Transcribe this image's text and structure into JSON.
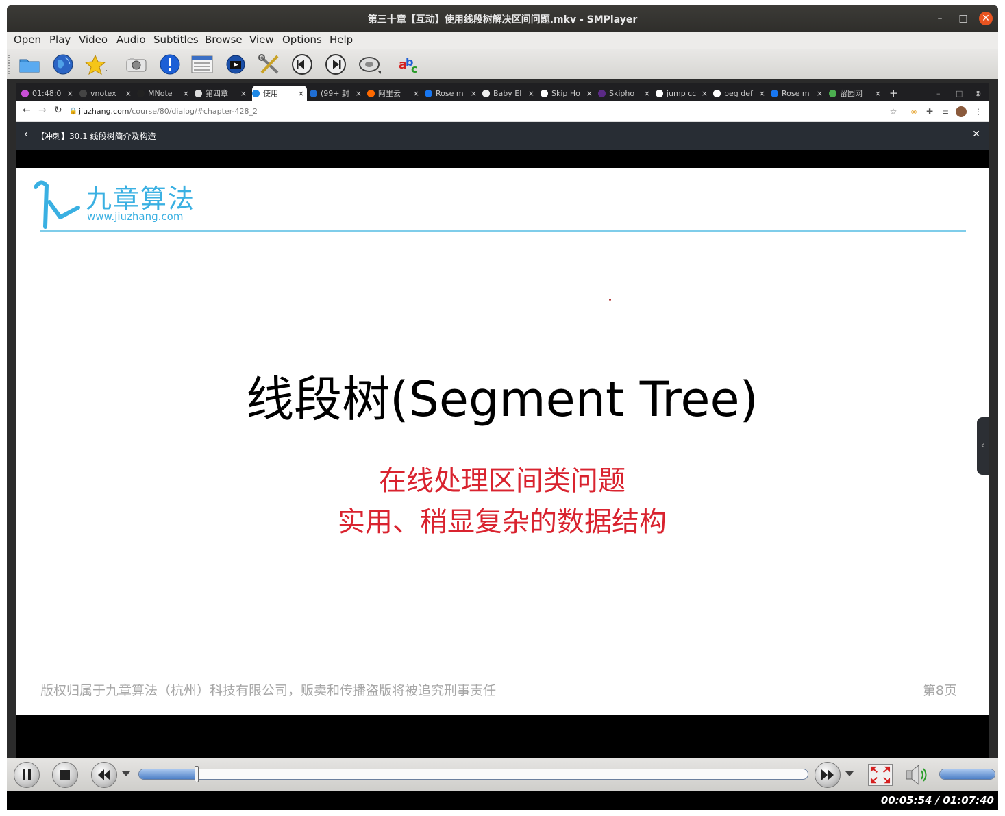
{
  "window": {
    "title": "第三十章【互动】使用线段树解决区间问题.mkv - SMPlayer",
    "minimize": "–",
    "maximize": "□",
    "close": "✕"
  },
  "menu": [
    "Open",
    "Play",
    "Video",
    "Audio",
    "Subtitles",
    "Browse",
    "View",
    "Options",
    "Help"
  ],
  "toolbar_icons": [
    "open-folder-icon",
    "globe-icon",
    "favorites-star-icon",
    "screenshot-camera-icon",
    "info-icon",
    "playlist-icon",
    "film-icon",
    "preferences-tools-icon",
    "previous-icon",
    "next-icon",
    "disc-icon",
    "subtitles-abc-icon"
  ],
  "browser": {
    "tabs": [
      {
        "label": "01:48:0",
        "color": "#c84fd6"
      },
      {
        "label": "vnotex",
        "color": "#444444"
      },
      {
        "label": "MNote",
        "color": "#222222"
      },
      {
        "label": "第四章",
        "color": "#dddddd"
      },
      {
        "label": "使用",
        "color": "#1e88e5",
        "active": true
      },
      {
        "label": "(99+ 封",
        "color": "#1f6ed4"
      },
      {
        "label": "阿里云",
        "color": "#ff6a00"
      },
      {
        "label": "Rose m",
        "color": "#1877f2"
      },
      {
        "label": "Baby El",
        "color": "#eeeeee"
      },
      {
        "label": "Skip Ho",
        "color": "#ffffff"
      },
      {
        "label": "Skipho",
        "color": "#5b2a86"
      },
      {
        "label": "jump cc",
        "color": "#ffffff"
      },
      {
        "label": "peg def",
        "color": "#ffffff"
      },
      {
        "label": "Rose m",
        "color": "#1877f2"
      },
      {
        "label": "留园网",
        "color": "#4caf50"
      }
    ],
    "tab_close": "×",
    "new_tab": "+",
    "url_host": "jiuzhang.com",
    "url_path": "/course/80/dialog/#chapter-428_2",
    "course_title": "【冲刺】30.1 线段树简介及构造"
  },
  "slide": {
    "logo_text": "九章算法",
    "logo_url": "www.jiuzhang.com",
    "title": "线段树(Segment Tree)",
    "subtitle1": "在线处理区间类问题",
    "subtitle2": "实用、稍显复杂的数据结构",
    "copyright": "版权归属于九章算法（杭州）科技有限公司，贩卖和传播盗版将被追究刑事责任",
    "page": "第8页"
  },
  "player": {
    "position": "00:05:54",
    "duration": "01:07:40",
    "time_display": "00:05:54 / 01:07:40",
    "progress_fraction": 0.0872,
    "volume_fraction": 0.98
  }
}
